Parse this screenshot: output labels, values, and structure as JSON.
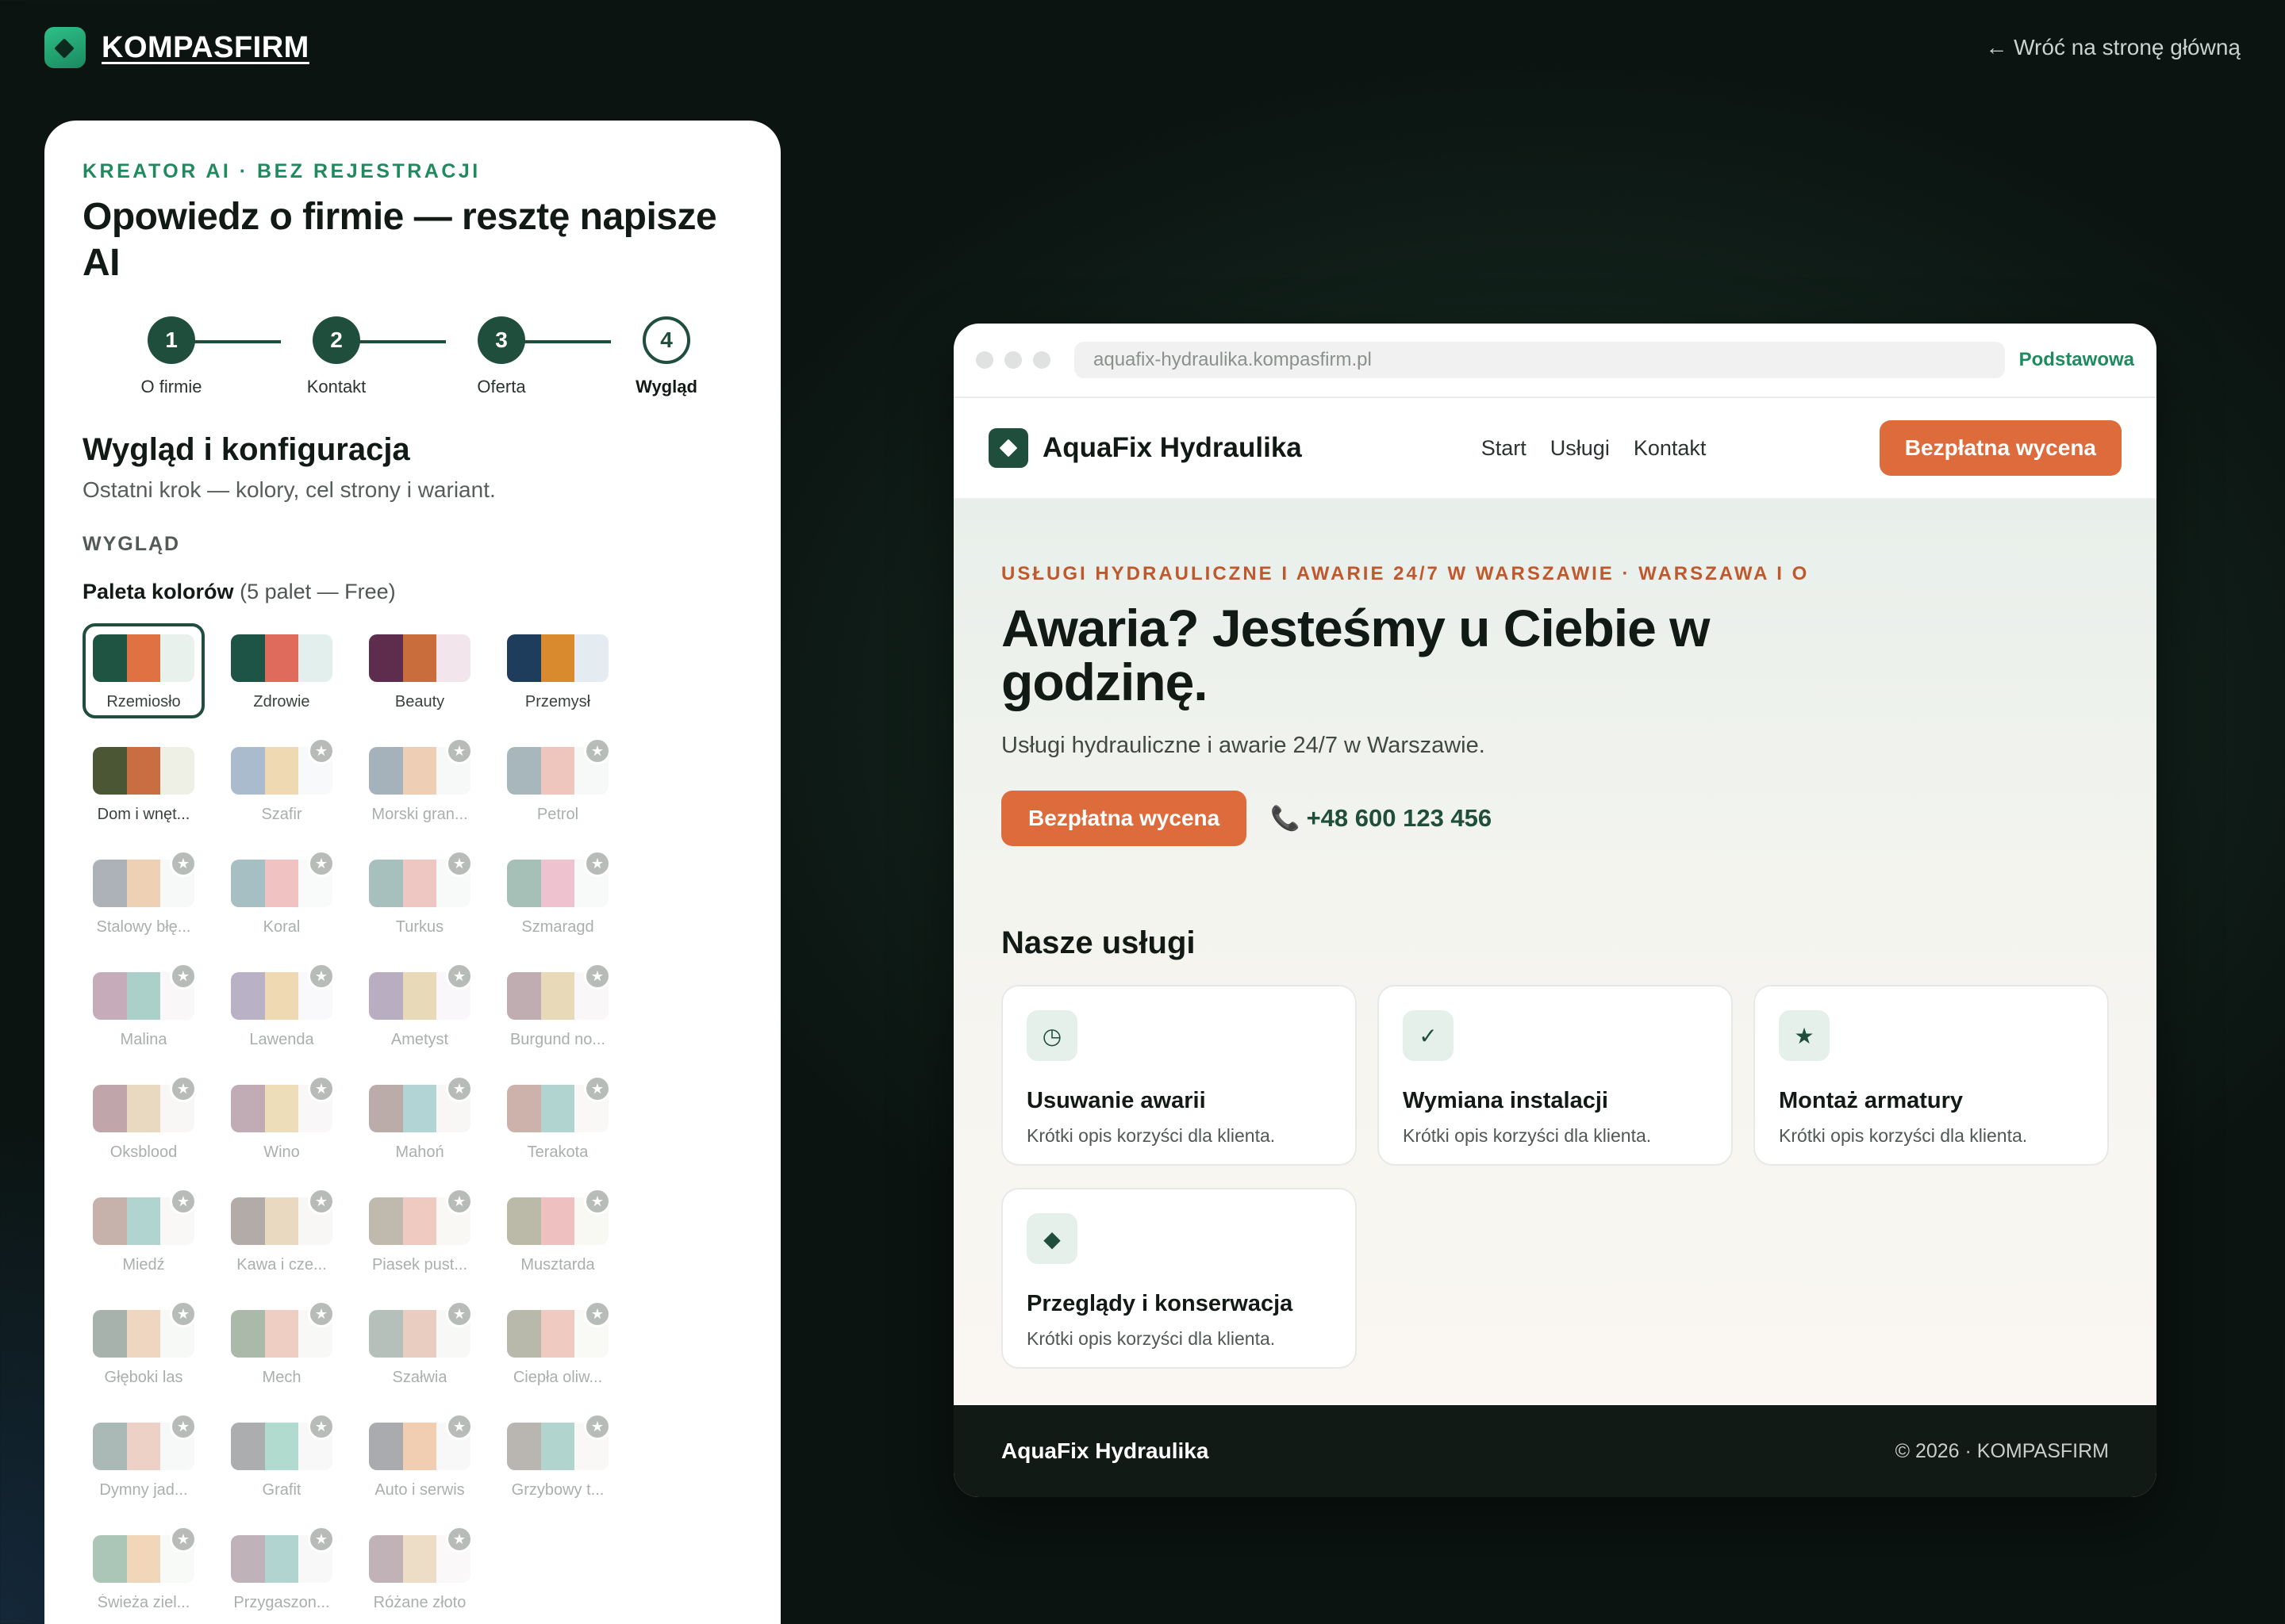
{
  "header": {
    "brand": "KOMPASFIRM",
    "back_link": "← Wróć na stronę główną"
  },
  "panel": {
    "eyebrow": "KREATOR AI · BEZ REJESTRACJI",
    "title": "Opowiedz o firmie — resztę napisze AI",
    "steps": [
      {
        "number": "1",
        "label": "O firmie"
      },
      {
        "number": "2",
        "label": "Kontakt"
      },
      {
        "number": "3",
        "label": "Oferta"
      },
      {
        "number": "4",
        "label": "Wygląd"
      }
    ],
    "section_title": "Wygląd i konfiguracja",
    "section_subtitle": "Ostatni krok — kolory, cel strony i wariant.",
    "group_label": "WYGLĄD",
    "palette_label": "Paleta kolorów",
    "palette_note": "(5 palet — Free)",
    "lock_glyph": "★",
    "palettes": [
      {
        "name": "Rzemiosło",
        "colors": [
          "#1f5443",
          "#e07143",
          "#e9f1ec"
        ],
        "locked": false,
        "selected": true
      },
      {
        "name": "Zdrowie",
        "colors": [
          "#1e5446",
          "#de6b5c",
          "#e2efec"
        ],
        "locked": false,
        "selected": false
      },
      {
        "name": "Beauty",
        "colors": [
          "#5e2d4e",
          "#c96d3d",
          "#f2e6ec"
        ],
        "locked": false,
        "selected": false
      },
      {
        "name": "Przemysł",
        "colors": [
          "#1e3c5c",
          "#d98a2e",
          "#e4ecf1"
        ],
        "locked": false,
        "selected": false
      },
      {
        "name": "Dom i wnęt...",
        "colors": [
          "#4a5634",
          "#c96d42",
          "#eef0e5"
        ],
        "locked": false,
        "selected": false
      },
      {
        "name": "Szafir",
        "colors": [
          "#3a5f8c",
          "#d9a54a",
          "#eef2f7"
        ],
        "locked": true,
        "selected": false
      },
      {
        "name": "Morski gran...",
        "colors": [
          "#2d4a5e",
          "#d98c4f",
          "#eef2f3"
        ],
        "locked": true,
        "selected": false
      },
      {
        "name": "Petrol",
        "colors": [
          "#2f5560",
          "#d97a66",
          "#edf3f3"
        ],
        "locked": true,
        "selected": false
      },
      {
        "name": "Stalowy błę...",
        "colors": [
          "#3d4a5a",
          "#d9944f",
          "#eef1f3"
        ],
        "locked": true,
        "selected": false
      },
      {
        "name": "Koral",
        "colors": [
          "#2e6870",
          "#e07070",
          "#f2f4f4"
        ],
        "locked": true,
        "selected": false
      },
      {
        "name": "Turkus",
        "colors": [
          "#2f6a64",
          "#d97a70",
          "#eef4f2"
        ],
        "locked": true,
        "selected": false
      },
      {
        "name": "Szmaragd",
        "colors": [
          "#2f6a55",
          "#d9708c",
          "#eef4f0"
        ],
        "locked": true,
        "selected": false
      },
      {
        "name": "Malina",
        "colors": [
          "#7a3a5e",
          "#3a9080",
          "#f4eef1"
        ],
        "locked": true,
        "selected": false
      },
      {
        "name": "Lawenda",
        "colors": [
          "#5a4a7a",
          "#d9a54a",
          "#f2eff5"
        ],
        "locked": true,
        "selected": false
      },
      {
        "name": "Ametyst",
        "colors": [
          "#5a3d6e",
          "#c9a55a",
          "#f1eef3"
        ],
        "locked": true,
        "selected": false
      },
      {
        "name": "Burgund no...",
        "colors": [
          "#6a3d4a",
          "#c9a55a",
          "#f3eeee"
        ],
        "locked": true,
        "selected": false
      },
      {
        "name": "Oksblood",
        "colors": [
          "#6a2e38",
          "#c9a56a",
          "#f3eeec"
        ],
        "locked": true,
        "selected": false
      },
      {
        "name": "Wino",
        "colors": [
          "#6e3a4e",
          "#d9b05a",
          "#f3eef0"
        ],
        "locked": true,
        "selected": false
      },
      {
        "name": "Mahoń",
        "colors": [
          "#5e3a34",
          "#4a9a9a",
          "#f1eeec"
        ],
        "locked": true,
        "selected": false
      },
      {
        "name": "Terakota",
        "colors": [
          "#8a4a3a",
          "#4a9a90",
          "#f4efec"
        ],
        "locked": true,
        "selected": false
      },
      {
        "name": "Miedź",
        "colors": [
          "#7a4a3a",
          "#4a9a94",
          "#f3efeb"
        ],
        "locked": true,
        "selected": false
      },
      {
        "name": "Kawa i cze...",
        "colors": [
          "#4a3a30",
          "#c9a56a",
          "#f2eee9"
        ],
        "locked": true,
        "selected": false
      },
      {
        "name": "Piasek pust...",
        "colors": [
          "#6a5a40",
          "#d9826a",
          "#f4f0e8"
        ],
        "locked": true,
        "selected": false
      },
      {
        "name": "Musztarda",
        "colors": [
          "#5e5a30",
          "#d96a6a",
          "#f3f1e6"
        ],
        "locked": true,
        "selected": false
      },
      {
        "name": "Głęboki las",
        "colors": [
          "#2e4a3a",
          "#d9a06a",
          "#eef2ee"
        ],
        "locked": true,
        "selected": false
      },
      {
        "name": "Mech",
        "colors": [
          "#3a5a3a",
          "#d98a70",
          "#eff2ec"
        ],
        "locked": true,
        "selected": false
      },
      {
        "name": "Szałwia",
        "colors": [
          "#4e6a5a",
          "#c98a6a",
          "#eff2ee"
        ],
        "locked": true,
        "selected": false
      },
      {
        "name": "Ciepła oliw...",
        "colors": [
          "#5a5a3a",
          "#d9826a",
          "#f2f1ea"
        ],
        "locked": true,
        "selected": false
      },
      {
        "name": "Dymny jad...",
        "colors": [
          "#3a5a54",
          "#d9947a",
          "#eef2f0"
        ],
        "locked": true,
        "selected": false
      },
      {
        "name": "Grafit",
        "colors": [
          "#3a3e42",
          "#4aaa90",
          "#eff0f0"
        ],
        "locked": true,
        "selected": false
      },
      {
        "name": "Auto i serwis",
        "colors": [
          "#343a40",
          "#e08a4a",
          "#eff0f0"
        ],
        "locked": true,
        "selected": false
      },
      {
        "name": "Grzybowy t...",
        "colors": [
          "#5a5046",
          "#4a9a8c",
          "#f2f0ec"
        ],
        "locked": true,
        "selected": false
      },
      {
        "name": "Świeża ziel...",
        "colors": [
          "#3a7a54",
          "#e0a05a",
          "#eef4ee"
        ],
        "locked": true,
        "selected": false
      },
      {
        "name": "Przygaszon...",
        "colors": [
          "#6a4a5a",
          "#4a9a90",
          "#f3eff1"
        ],
        "locked": true,
        "selected": false
      },
      {
        "name": "Różane złoto",
        "colors": [
          "#6a4a54",
          "#d9b07a",
          "#f4efef"
        ],
        "locked": true,
        "selected": false
      }
    ]
  },
  "preview": {
    "url": "aquafix-hydraulika.kompasfirm.pl",
    "variant": "Podstawowa",
    "site_name": "AquaFix Hydraulika",
    "nav": [
      "Start",
      "Usługi",
      "Kontakt"
    ],
    "nav_cta": "Bezpłatna wycena",
    "hero_eyebrow": "USŁUGI HYDRAULICZNE I AWARIE 24/7 W WARSZAWIE · WARSZAWA I O",
    "hero_title": "Awaria? Jesteśmy u Ciebie w godzinę.",
    "hero_subtitle": "Usługi hydrauliczne i awarie 24/7 w Warszawie.",
    "hero_cta": "Bezpłatna wycena",
    "phone_icon": "📞",
    "phone": "+48 600 123 456",
    "services_title": "Nasze usługi",
    "services": [
      {
        "icon": "◷",
        "title": "Usuwanie awarii",
        "desc": "Krótki opis korzyści dla klienta."
      },
      {
        "icon": "✓",
        "title": "Wymiana instalacji",
        "desc": "Krótki opis korzyści dla klienta."
      },
      {
        "icon": "★",
        "title": "Montaż armatury",
        "desc": "Krótki opis korzyści dla klienta."
      },
      {
        "icon": "◆",
        "title": "Przeglądy i konserwacja",
        "desc": "Krótki opis korzyści dla klienta."
      }
    ],
    "footer_name": "AquaFix Hydraulika",
    "footer_copy": "© 2026 · KOMPASFIRM"
  },
  "colors": {
    "brand_green": "#1f4e3d",
    "accent_orange": "#de6b3c",
    "eyebrow_green": "#1e8a5e"
  }
}
